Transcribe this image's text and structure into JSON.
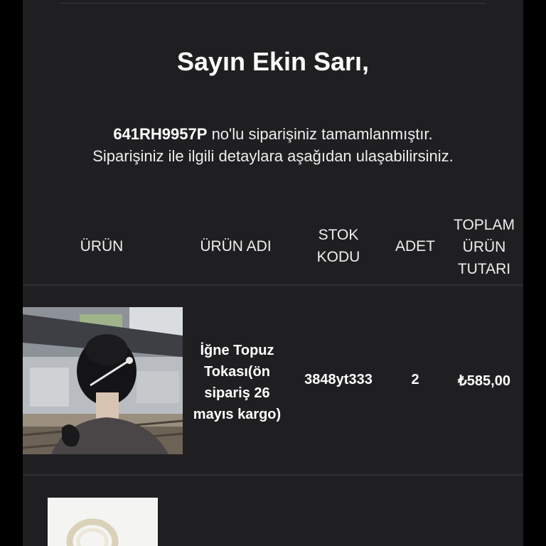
{
  "greeting": "Sayın Ekin Sarı,",
  "message": {
    "order_no": "641RH9957P",
    "line1_rest": "no'lu siparişiniz tamamlanmıştır.",
    "line2": "Siparişiniz ile ilgili detaylara aşağıdan ulaşabilirsiniz."
  },
  "table": {
    "headers": {
      "urun": "ÜRÜN",
      "urun_adi": "ÜRÜN ADI",
      "stok_kodu_1": "STOK",
      "stok_kodu_2": "KODU",
      "adet": "ADET",
      "toplam_1": "TOPLAM",
      "toplam_2": "ÜRÜN",
      "toplam_3": "TUTARI"
    },
    "rows": [
      {
        "name_1": "İğne Topuz",
        "name_2": "Tokası(ön",
        "name_3": "sipariş 26",
        "name_4": "mayıs kargo)",
        "stock_code": "3848yt333",
        "quantity": "2",
        "total": "₺585,00"
      }
    ]
  }
}
